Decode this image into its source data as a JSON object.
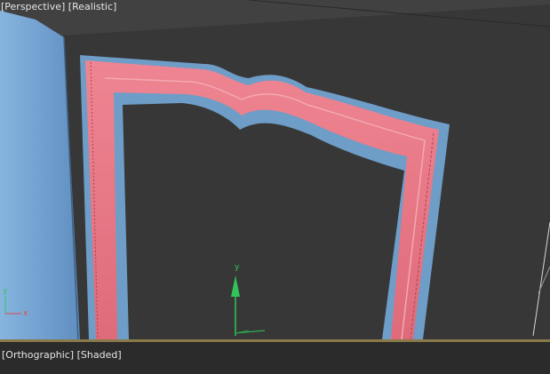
{
  "top_viewport": {
    "label_parts": [
      "[",
      "Perspective",
      "]",
      "[",
      "Realistic",
      "]"
    ],
    "view_menu": "Perspective",
    "shading_menu": "Realistic"
  },
  "bottom_viewport": {
    "view_menu": "Orthographic",
    "shading_menu": "Shaded"
  },
  "gizmo": {
    "x_label": "x",
    "y_label": "y"
  },
  "colors": {
    "viewport_bg": "#414141",
    "wall": "#6c9cc8",
    "frame_blue": "#6e9dc7",
    "frame_pink": "#e8707e",
    "x_axis": "#e04a4a",
    "y_axis": "#31c45b"
  }
}
